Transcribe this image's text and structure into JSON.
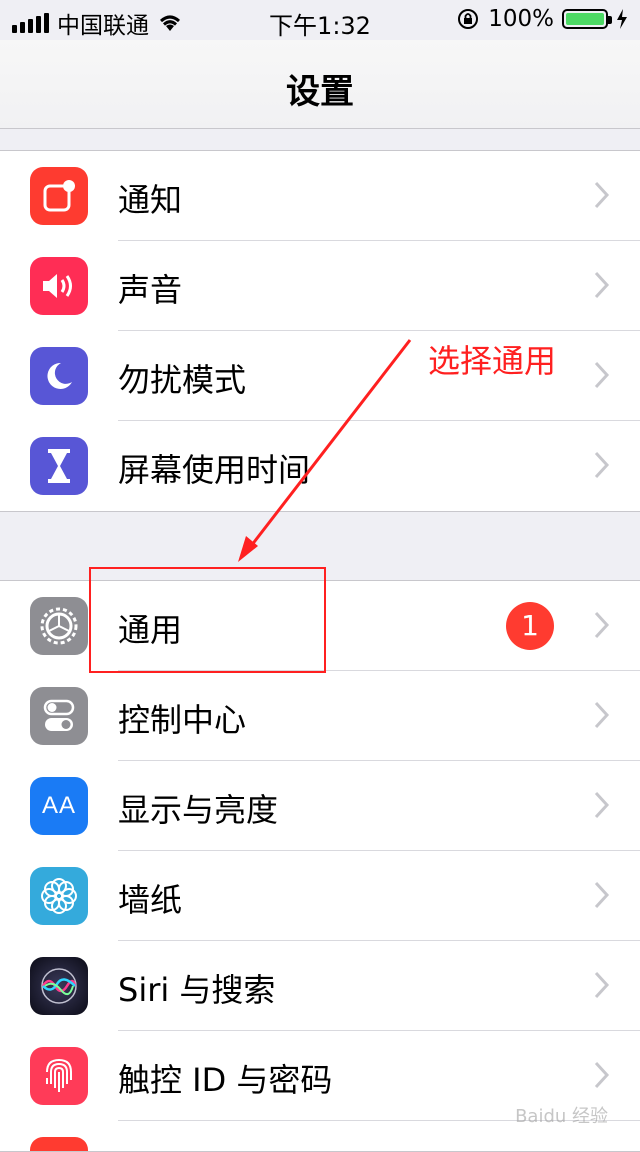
{
  "status_bar": {
    "carrier": "中国联通",
    "time": "下午1:32",
    "battery_percent": "100%",
    "icons": [
      "signal-icon",
      "wifi-icon",
      "lock-rotation-icon",
      "battery-icon",
      "charging-icon"
    ]
  },
  "nav": {
    "title": "设置"
  },
  "groups": [
    {
      "items": [
        {
          "label": "通知",
          "icon": "notifications-icon",
          "color": "#fe3b30"
        },
        {
          "label": "声音",
          "icon": "sounds-icon",
          "color": "#ff2d55"
        },
        {
          "label": "勿扰模式",
          "icon": "moon-icon",
          "color": "#5856d6"
        },
        {
          "label": "屏幕使用时间",
          "icon": "hourglass-icon",
          "color": "#5856d6"
        }
      ]
    },
    {
      "items": [
        {
          "label": "通用",
          "icon": "gear-icon",
          "color": "#8e8e93",
          "badge": "1"
        },
        {
          "label": "控制中心",
          "icon": "toggles-icon",
          "color": "#8e8e93"
        },
        {
          "label": "显示与亮度",
          "icon": "text-size-icon",
          "color": "#1a7bf5",
          "icon_text": "AA"
        },
        {
          "label": "墙纸",
          "icon": "flower-icon",
          "color": "#34aadc"
        },
        {
          "label": "Siri 与搜索",
          "icon": "siri-icon",
          "color": "#1a1a2e"
        },
        {
          "label": "触控 ID 与密码",
          "icon": "fingerprint-icon",
          "color": "#ff3b58"
        }
      ]
    }
  ],
  "annotation": {
    "text": "选择通用",
    "color": "#ff2020"
  },
  "watermark": "Baidu 经验"
}
